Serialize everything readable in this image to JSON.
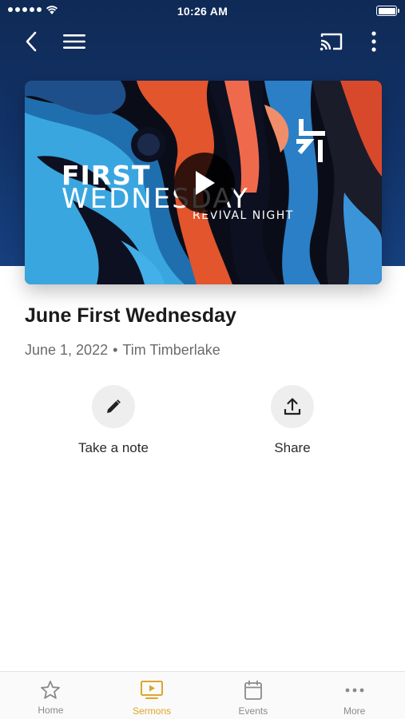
{
  "status_bar": {
    "time": "10:26 AM"
  },
  "sermon": {
    "title": "June First Wednesday",
    "date": "June 1, 2022",
    "separator": "•",
    "speaker": "Tim Timberlake",
    "artwork": {
      "line1": "FIRST",
      "line2": "WEDNESDAY",
      "line3": "REVIVAL NIGHT"
    }
  },
  "actions": [
    {
      "label": "Take a note",
      "icon": "pencil-icon"
    },
    {
      "label": "Share",
      "icon": "share-icon"
    }
  ],
  "tabs": [
    {
      "label": "Home",
      "icon": "star-icon",
      "active": false
    },
    {
      "label": "Sermons",
      "icon": "play-screen-icon",
      "active": true
    },
    {
      "label": "Events",
      "icon": "calendar-icon",
      "active": false
    },
    {
      "label": "More",
      "icon": "ellipsis-icon",
      "active": false
    }
  ],
  "colors": {
    "header": "#12336a",
    "accent_active_tab": "#e0a42a",
    "inactive_tab": "#8a8a8a"
  }
}
